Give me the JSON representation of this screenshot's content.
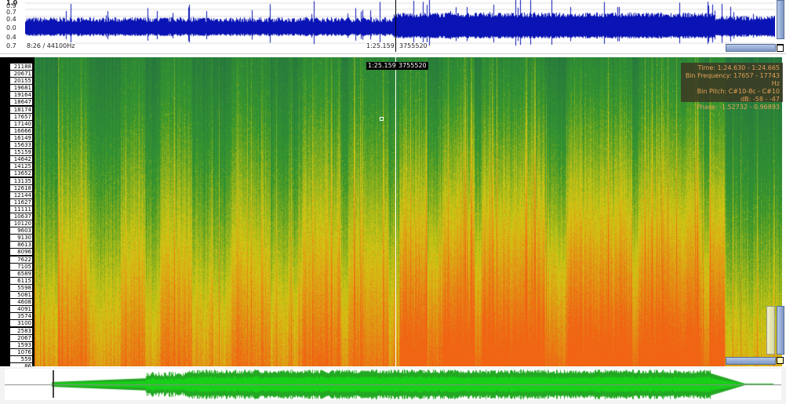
{
  "waveform": {
    "amplitude_labels": [
      "1.0",
      "0.9",
      "0.7",
      "0.4",
      "0.0",
      "0.4",
      "0.7"
    ],
    "duration_info": "8:26 / 44100Hz",
    "cursor_time": "1:25.159",
    "cursor_sample": "3755520",
    "color": "#0a14b4"
  },
  "spectrogram": {
    "frequency_labels": [
      "21188",
      "20671",
      "20155",
      "19681",
      "19164",
      "18647",
      "18174",
      "17657",
      "17140",
      "16666",
      "16149",
      "15633",
      "15159",
      "14642",
      "14125",
      "13652",
      "13135",
      "12618",
      "12144",
      "11627",
      "11111",
      "10637",
      "10120",
      "9603",
      "9130",
      "8613",
      "8096",
      "7622",
      "7105",
      "6589",
      "6115",
      "5598",
      "5081",
      "4608",
      "4091",
      "3574",
      "3100",
      "2583",
      "2067",
      "1593",
      "1076",
      "559",
      "86"
    ],
    "cursor_time": "1:25.159",
    "cursor_sample": "3755520",
    "colors": {
      "low": "#1e6e4a",
      "mid": "#8cb830",
      "high": "#e06a20"
    }
  },
  "tooltip": {
    "time": "Time: 1:24.630 - 1:24.665",
    "bin_frequency": "Bin Frequency: 17657 - 17743 Hz",
    "bin_pitch": "Bin Pitch: C#10-8c - C#10",
    "db": "dB: -58 - -47",
    "phase": "Phase: -1.52732 - 0.96893"
  },
  "overview": {
    "color": "#1aa01a"
  }
}
